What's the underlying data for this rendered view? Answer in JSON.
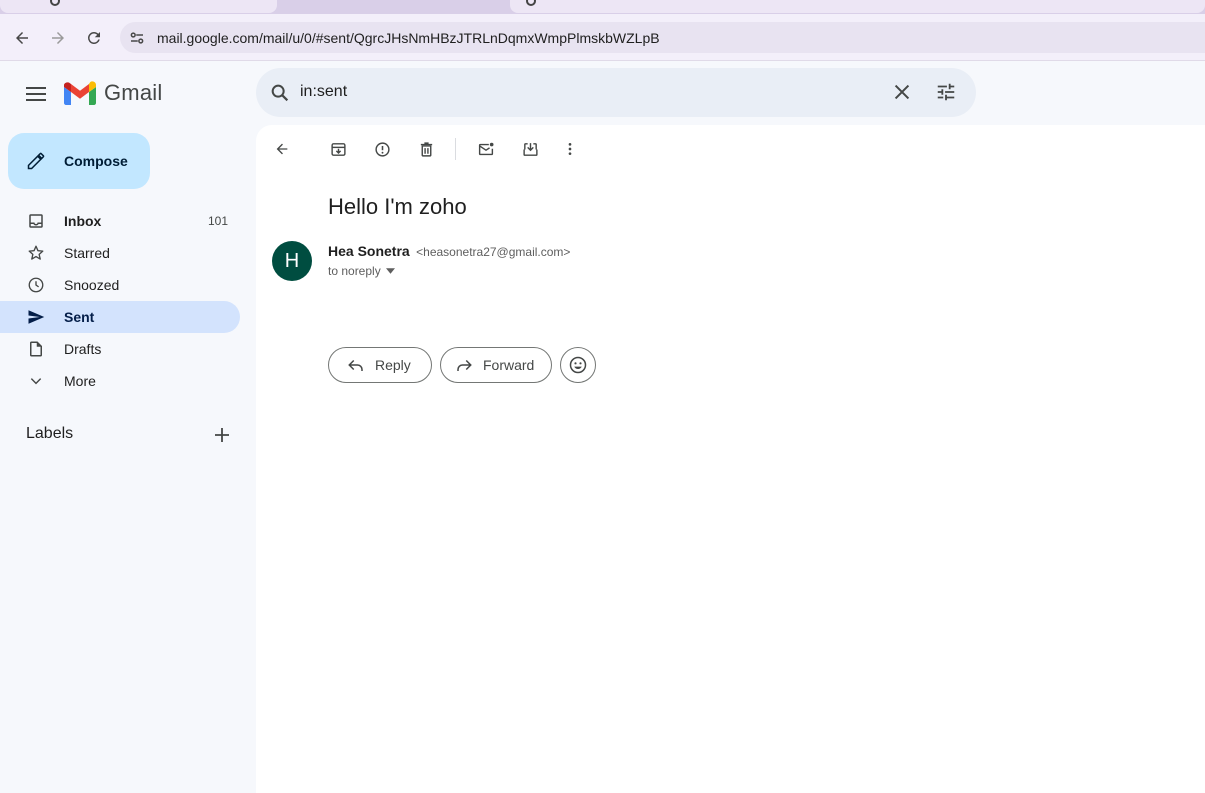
{
  "browser": {
    "url": "mail.google.com/mail/u/0/#sent/QgrcJHsNmHBzJTRLnDqmxWmpPlmskbWZLpB"
  },
  "app": {
    "name": "Gmail"
  },
  "search": {
    "query": "in:sent"
  },
  "compose": {
    "label": "Compose"
  },
  "sidebar": {
    "items": [
      {
        "label": "Inbox",
        "count": "101"
      },
      {
        "label": "Starred"
      },
      {
        "label": "Snoozed"
      },
      {
        "label": "Sent"
      },
      {
        "label": "Drafts"
      },
      {
        "label": "More"
      }
    ],
    "labels_header": "Labels"
  },
  "message": {
    "subject": "Hello I'm zoho",
    "avatar_initial": "H",
    "avatar_color": "#004d40",
    "sender_name": "Hea Sonetra",
    "sender_email": "<heasonetra27@gmail.com>",
    "recipient": "to noreply"
  },
  "actions": {
    "reply": "Reply",
    "forward": "Forward"
  },
  "colors": {
    "compose_bg": "#c2e7ff",
    "active_nav_bg": "#d3e3fd",
    "search_bg": "#e9eef6"
  }
}
